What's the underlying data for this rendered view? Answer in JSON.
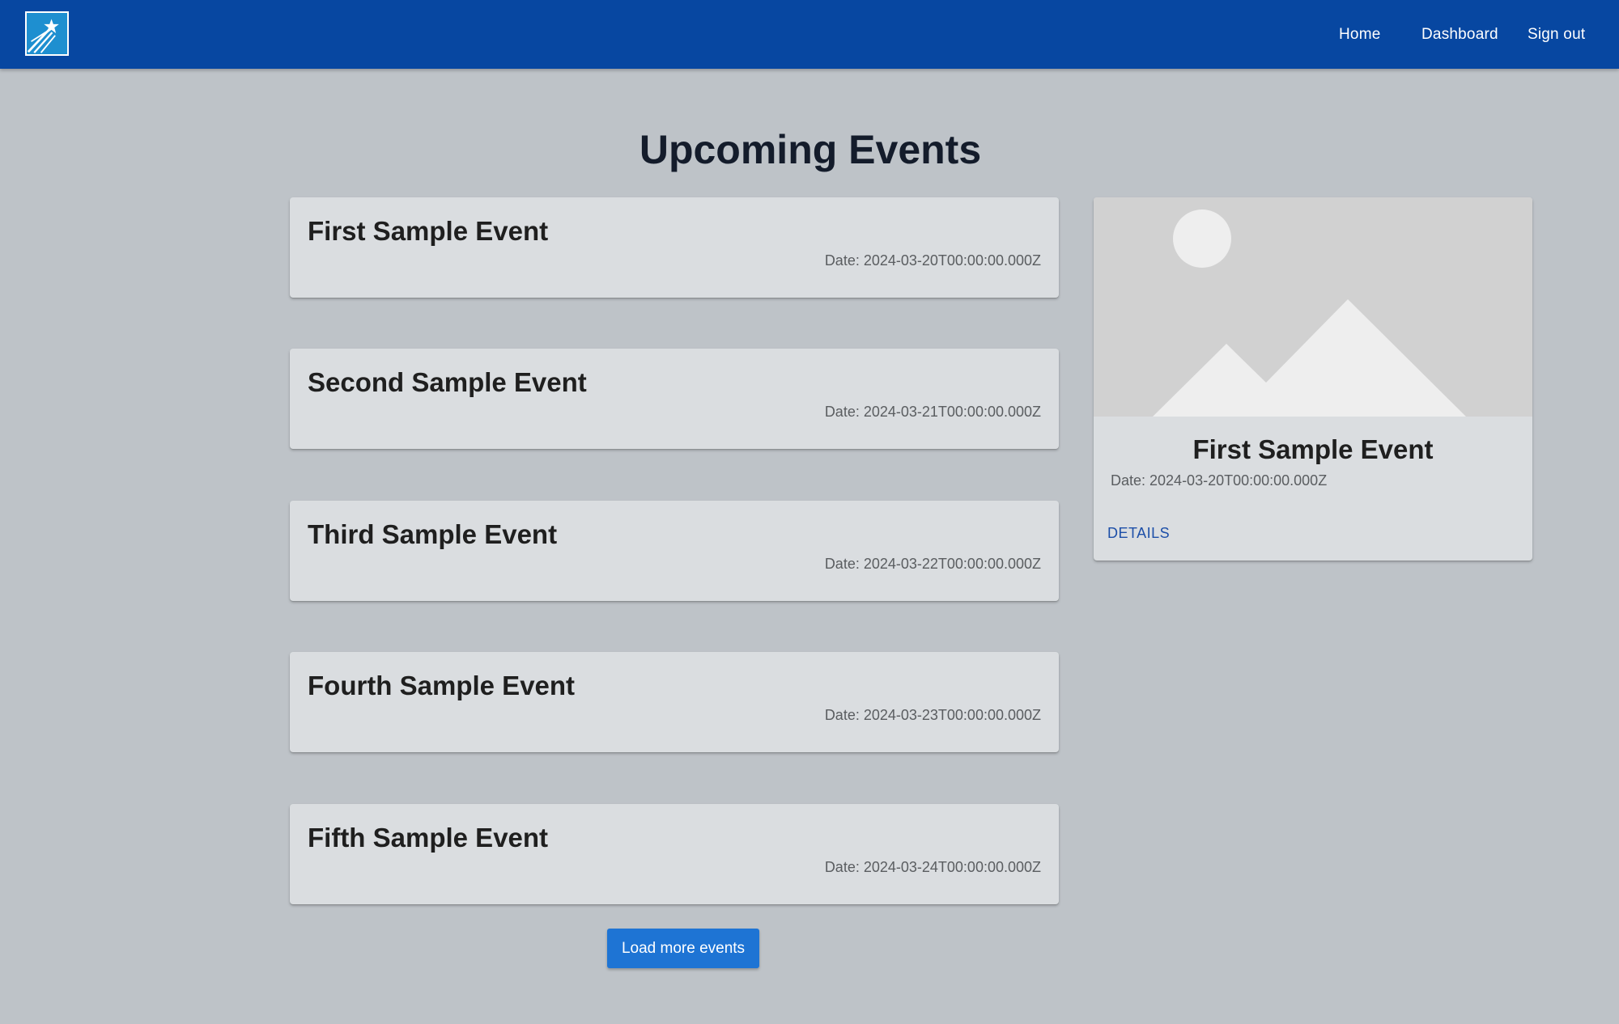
{
  "nav": {
    "logo_icon": "plane-star-logo-icon",
    "links": [
      {
        "label": "Home"
      },
      {
        "label": "Dashboard"
      },
      {
        "label": "Sign out"
      }
    ]
  },
  "page": {
    "title": "Upcoming Events"
  },
  "events": [
    {
      "title": "First Sample Event",
      "date": "Date: 2024-03-20T00:00:00.000Z"
    },
    {
      "title": "Second Sample Event",
      "date": "Date: 2024-03-21T00:00:00.000Z"
    },
    {
      "title": "Third Sample Event",
      "date": "Date: 2024-03-22T00:00:00.000Z"
    },
    {
      "title": "Fourth Sample Event",
      "date": "Date: 2024-03-23T00:00:00.000Z"
    },
    {
      "title": "Fifth Sample Event",
      "date": "Date: 2024-03-24T00:00:00.000Z"
    }
  ],
  "load_more": {
    "label": "Load more events"
  },
  "featured": {
    "image_icon": "image-placeholder-icon",
    "title": "First Sample Event",
    "date": "Date: 2024-03-20T00:00:00.000Z",
    "details_label": "DETAILS"
  },
  "colors": {
    "navbar": "#0747a1",
    "background": "#bec3c8",
    "card": "#dadde0",
    "button": "#1e74d4",
    "link": "#1d4fa8"
  }
}
